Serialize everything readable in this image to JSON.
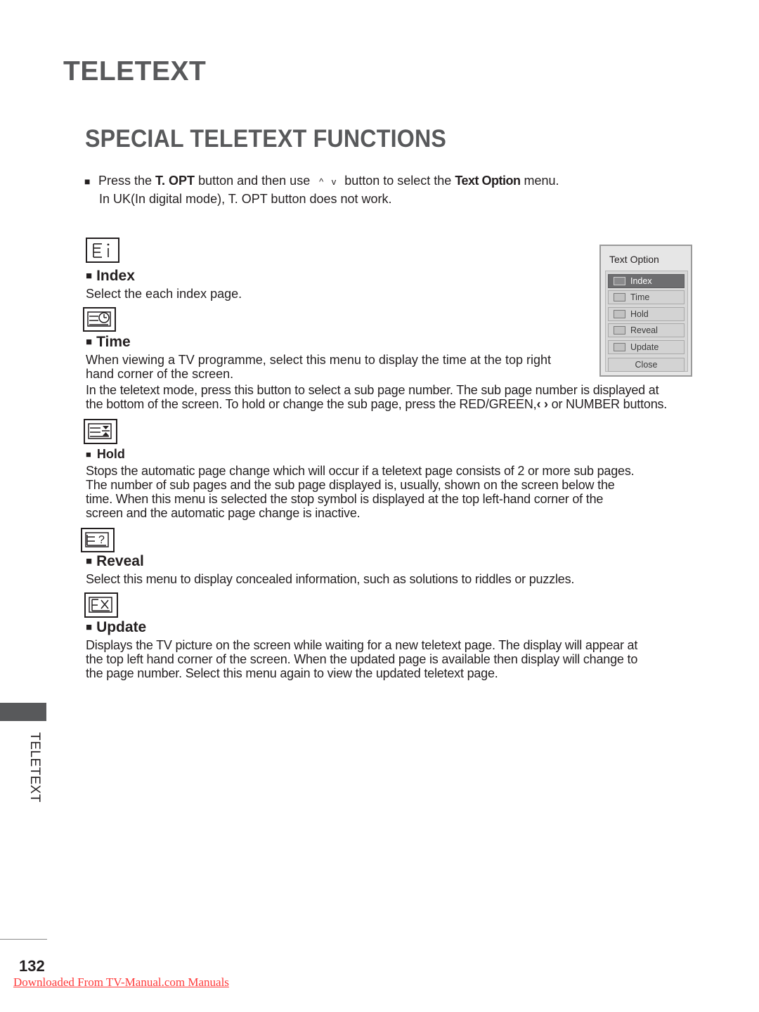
{
  "chapter_title": "TELETEXT",
  "section_title": "SPECIAL TELETEXT FUNCTIONS",
  "intro": {
    "bullet": "■",
    "line1_parts": [
      "Press the ",
      "T. OPT",
      " button and then use ",
      "button to select the ",
      "Text Option",
      " menu."
    ],
    "arrow_icons": "up-arrow, down-arrow",
    "arrows_glyph": "^ v",
    "line2": "In UK(In digital mode), T. OPT button does not work."
  },
  "functions": [
    {
      "id": "index",
      "icon": "index-icon",
      "title": "Index",
      "paragraphs": [
        "Select the each index page."
      ]
    },
    {
      "id": "time",
      "icon": "time-icon",
      "title": "Time",
      "paragraphs": [
        "When viewing a TV programme, select this menu to display the time at the top right",
        "hand corner of the screen.",
        "In the teletext mode, press this button to select a sub page number. The sub page number is displayed at",
        "the bottom of the screen. To hold or change the sub page, press the RED/GREEN,",
        " or NUMBER buttons."
      ]
    },
    {
      "id": "hold",
      "icon": "hold-icon",
      "title": "Hold",
      "paragraphs": [
        "Stops the automatic page change which will occur if a teletext page consists of 2 or more sub pages.",
        "The number of sub pages and the sub page displayed is, usually, shown on the screen below the",
        "time. When this menu is selected the stop symbol is displayed at the top left-hand corner of the",
        "screen and the automatic page change is inactive."
      ]
    },
    {
      "id": "reveal",
      "icon": "reveal-icon",
      "title": "Reveal",
      "paragraphs": [
        "Select this menu to display concealed information, such as solutions to riddles or puzzles."
      ]
    },
    {
      "id": "update",
      "icon": "update-icon",
      "title": "Update",
      "paragraphs": [
        "Displays the TV picture on the screen while waiting for a new teletext page. The display will appear at",
        "the top left hand corner of the screen. When the updated page is available then display will change to",
        "the page number. Select this menu again to view the updated teletext page."
      ]
    }
  ],
  "lr_arrows_glyph": "‹ ›",
  "text_option_panel": {
    "title": "Text Option",
    "items": [
      {
        "label": "Index",
        "icon": "index-icon",
        "selected": true
      },
      {
        "label": "Time",
        "icon": "time-icon",
        "selected": false
      },
      {
        "label": "Hold",
        "icon": "hold-icon",
        "selected": false
      },
      {
        "label": "Reveal",
        "icon": "reveal-icon",
        "selected": false
      },
      {
        "label": "Update",
        "icon": "update-icon",
        "selected": false
      }
    ],
    "close_label": "Close"
  },
  "side_tab_label": "TELETEXT",
  "page_number": "132",
  "footer_link": "Downloaded From TV-Manual.com Manuals",
  "colors": {
    "heading_gray": "#58595b",
    "link_red": "#ff3b3b",
    "selected_item": "#6e6e70"
  }
}
